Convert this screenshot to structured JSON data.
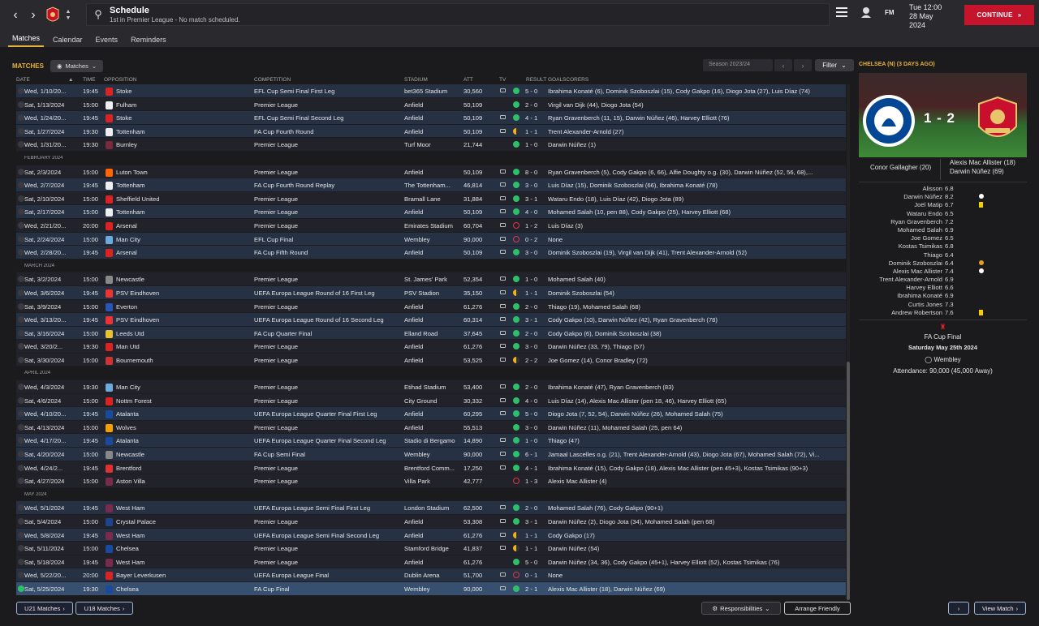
{
  "header": {
    "title": "Schedule",
    "subtitle": "1st in Premier League - No match scheduled.",
    "day_time": "Tue 12:00",
    "date_line1": "28 May",
    "date_line2": "2024",
    "fm": "FM",
    "continue_label": "CONTINUE"
  },
  "tabs": [
    "Matches",
    "Calendar",
    "Events",
    "Reminders"
  ],
  "toolbar": {
    "section_label": "MATCHES",
    "view_dropdown": "Matches",
    "season": "Season 2023/24",
    "filter": "Filter"
  },
  "columns": {
    "date": "DATE",
    "time": "TIME",
    "opposition": "OPPOSITION",
    "competition": "COMPETITION",
    "stadium": "STADIUM",
    "att": "ATT",
    "tv": "TV",
    "result": "RESULT",
    "goalscorers": "GOALSCORERS"
  },
  "colors": {
    "accent": "#e8b23a",
    "continue": "#c5142c",
    "win": "#2fbf6a",
    "loss": "#e0364c",
    "draw": "#f0b020",
    "row_home": "#263244",
    "row_alt": "#22222a",
    "row_selected": "#37506f"
  },
  "rows": [
    {
      "date": "Wed, 1/10/20...",
      "time": "19:45",
      "opp": "Stoke",
      "comp": "EFL Cup Semi Final First Leg",
      "stadium": "bet365 Stadium",
      "att": "30,560",
      "tv": true,
      "res": "w",
      "score": "5 - 0",
      "scorers": "Ibrahima Konaté (6), Dominik Szoboszlai (15), Cody Gakpo (16), Diogo Jota (27), Luis Díaz (74)",
      "crest": "#d22",
      "cls": "odd"
    },
    {
      "date": "Sat, 1/13/2024",
      "time": "15:00",
      "opp": "Fulham",
      "comp": "Premier League",
      "stadium": "Anfield",
      "att": "50,109",
      "tv": false,
      "res": "w",
      "score": "2 - 0",
      "scorers": "Virgil van Dijk (44), Diogo Jota (54)",
      "crest": "#eee",
      "cls": "even"
    },
    {
      "date": "Wed, 1/24/20...",
      "time": "19:45",
      "opp": "Stoke",
      "comp": "EFL Cup Semi Final Second Leg",
      "stadium": "Anfield",
      "att": "50,109",
      "tv": true,
      "res": "w",
      "score": "4 - 1",
      "scorers": "Ryan Gravenberch (11, 15), Darwin Núñez (46), Harvey Elliott (76)",
      "crest": "#d22",
      "cls": "odd"
    },
    {
      "date": "Sat, 1/27/2024",
      "time": "19:30",
      "opp": "Tottenham",
      "comp": "FA Cup Fourth Round",
      "stadium": "Anfield",
      "att": "50,109",
      "tv": true,
      "res": "d",
      "score": "1 - 1",
      "scorers": "Trent Alexander-Arnold (27)",
      "crest": "#eee",
      "cls": "odd"
    },
    {
      "date": "Wed, 1/31/20...",
      "time": "19:30",
      "opp": "Burnley",
      "comp": "Premier League",
      "stadium": "Turf Moor",
      "att": "21,744",
      "tv": false,
      "res": "w",
      "score": "1 - 0",
      "scorers": "Darwin Núñez (1)",
      "crest": "#7a2a3a",
      "cls": "even"
    },
    {
      "sep": "FEBRUARY 2024"
    },
    {
      "date": "Sat, 2/3/2024",
      "time": "15:00",
      "opp": "Luton Town",
      "comp": "Premier League",
      "stadium": "Anfield",
      "att": "50,109",
      "tv": true,
      "res": "w",
      "score": "8 - 0",
      "scorers": "Ryan Gravenberch (5), Cody Gakpo (6, 66), Alfie Doughty o.g. (30), Darwin Núñez (52, 56, 68),...",
      "crest": "#f60",
      "cls": "even"
    },
    {
      "date": "Wed, 2/7/2024",
      "time": "19:45",
      "opp": "Tottenham",
      "comp": "FA Cup Fourth Round Replay",
      "stadium": "The Tottenham...",
      "att": "46,814",
      "tv": true,
      "res": "w",
      "score": "3 - 0",
      "scorers": "Luis Díaz (15), Dominik Szoboszlai (66), Ibrahima Konaté (78)",
      "crest": "#eee",
      "cls": "odd"
    },
    {
      "date": "Sat, 2/10/2024",
      "time": "15:00",
      "opp": "Sheffield United",
      "comp": "Premier League",
      "stadium": "Bramall Lane",
      "att": "31,884",
      "tv": true,
      "res": "w",
      "score": "3 - 1",
      "scorers": "Wataru Endo (18), Luis Díaz (42), Diogo Jota (89)",
      "crest": "#d22",
      "cls": "even"
    },
    {
      "date": "Sat, 2/17/2024",
      "time": "15:00",
      "opp": "Tottenham",
      "comp": "Premier League",
      "stadium": "Anfield",
      "att": "50,109",
      "tv": true,
      "res": "w",
      "score": "4 - 0",
      "scorers": "Mohamed Salah (10, pen 88), Cody Gakpo (25), Harvey Elliott (68)",
      "crest": "#eee",
      "cls": "odd"
    },
    {
      "date": "Wed, 2/21/20...",
      "time": "20:00",
      "opp": "Arsenal",
      "comp": "Premier League",
      "stadium": "Emirates Stadium",
      "att": "60,704",
      "tv": true,
      "res": "l",
      "score": "1 - 2",
      "scorers": "Luis Díaz (3)",
      "crest": "#d22",
      "cls": "even"
    },
    {
      "date": "Sat, 2/24/2024",
      "time": "15:00",
      "opp": "Man City",
      "comp": "EFL Cup Final",
      "stadium": "Wembley",
      "att": "90,000",
      "tv": true,
      "res": "l",
      "score": "0 - 2",
      "scorers": "None",
      "crest": "#6cabdd",
      "cls": "odd"
    },
    {
      "date": "Wed, 2/28/20...",
      "time": "19:45",
      "opp": "Arsenal",
      "comp": "FA Cup Fifth Round",
      "stadium": "Anfield",
      "att": "50,109",
      "tv": true,
      "res": "w",
      "score": "3 - 0",
      "scorers": "Dominik Szoboszlai (19), Virgil van Dijk (41), Trent Alexander-Arnold (52)",
      "crest": "#d22",
      "cls": "odd"
    },
    {
      "sep": "MARCH 2024"
    },
    {
      "date": "Sat, 3/2/2024",
      "time": "15:00",
      "opp": "Newcastle",
      "comp": "Premier League",
      "stadium": "St. James' Park",
      "att": "52,354",
      "tv": true,
      "res": "w",
      "score": "1 - 0",
      "scorers": "Mohamed Salah (40)",
      "crest": "#888",
      "cls": "even"
    },
    {
      "date": "Wed, 3/6/2024",
      "time": "19:45",
      "opp": "PSV Eindhoven",
      "comp": "UEFA Europa League Round of 16 First Leg",
      "stadium": "PSV Stadion",
      "att": "35,150",
      "tv": true,
      "res": "d",
      "score": "1 - 1",
      "scorers": "Dominik Szoboszlai (54)",
      "crest": "#e33",
      "cls": "odd"
    },
    {
      "date": "Sat, 3/9/2024",
      "time": "15:00",
      "opp": "Everton",
      "comp": "Premier League",
      "stadium": "Anfield",
      "att": "61,276",
      "tv": true,
      "res": "w",
      "score": "2 - 0",
      "scorers": "Thiago (19), Mohamed Salah (68)",
      "crest": "#2a55b8",
      "cls": "even"
    },
    {
      "date": "Wed, 3/13/20...",
      "time": "19:45",
      "opp": "PSV Eindhoven",
      "comp": "UEFA Europa League Round of 16 Second Leg",
      "stadium": "Anfield",
      "att": "60,314",
      "tv": true,
      "res": "w",
      "score": "3 - 1",
      "scorers": "Cody Gakpo (10), Darwin Núñez (42), Ryan Gravenberch (78)",
      "crest": "#e33",
      "cls": "odd"
    },
    {
      "date": "Sat, 3/16/2024",
      "time": "15:00",
      "opp": "Leeds Utd",
      "comp": "FA Cup Quarter Final",
      "stadium": "Elland Road",
      "att": "37,645",
      "tv": true,
      "res": "w",
      "score": "2 - 0",
      "scorers": "Cody Gakpo (6), Dominik Szoboszlai (38)",
      "crest": "#e8c030",
      "cls": "odd"
    },
    {
      "date": "Wed, 3/20/2...",
      "time": "19:30",
      "opp": "Man Utd",
      "comp": "Premier League",
      "stadium": "Anfield",
      "att": "61,276",
      "tv": true,
      "res": "w",
      "score": "3 - 0",
      "scorers": "Darwin Núñez (33, 79), Thiago (57)",
      "crest": "#d22",
      "cls": "even"
    },
    {
      "date": "Sat, 3/30/2024",
      "time": "15:00",
      "opp": "Bournemouth",
      "comp": "Premier League",
      "stadium": "Anfield",
      "att": "53,525",
      "tv": true,
      "res": "d",
      "score": "2 - 2",
      "scorers": "Joe Gomez (14), Conor Bradley (72)",
      "crest": "#c33",
      "cls": "even"
    },
    {
      "sep": "APRIL 2024"
    },
    {
      "date": "Wed, 4/3/2024",
      "time": "19:30",
      "opp": "Man City",
      "comp": "Premier League",
      "stadium": "Etihad Stadium",
      "att": "53,400",
      "tv": true,
      "res": "w",
      "score": "2 - 0",
      "scorers": "Ibrahima Konaté (47), Ryan Gravenberch (83)",
      "crest": "#6cabdd",
      "cls": "even"
    },
    {
      "date": "Sat, 4/6/2024",
      "time": "15:00",
      "opp": "Nottm Forest",
      "comp": "Premier League",
      "stadium": "City Ground",
      "att": "30,332",
      "tv": true,
      "res": "w",
      "score": "4 - 0",
      "scorers": "Luis Díaz (14), Alexis Mac Allister (pen 18, 46), Harvey Elliott (65)",
      "crest": "#d22",
      "cls": "even"
    },
    {
      "date": "Wed, 4/10/20...",
      "time": "19:45",
      "opp": "Atalanta",
      "comp": "UEFA Europa League Quarter Final First Leg",
      "stadium": "Anfield",
      "att": "60,295",
      "tv": true,
      "res": "w",
      "score": "5 - 0",
      "scorers": "Diogo Jota (7, 52, 54), Darwin Núñez (26), Mohamed Salah (75)",
      "crest": "#1a4aa0",
      "cls": "odd"
    },
    {
      "date": "Sat, 4/13/2024",
      "time": "15:00",
      "opp": "Wolves",
      "comp": "Premier League",
      "stadium": "Anfield",
      "att": "55,513",
      "tv": false,
      "res": "w",
      "score": "3 - 0",
      "scorers": "Darwin Núñez (11), Mohamed Salah (25, pen 64)",
      "crest": "#f5a000",
      "cls": "even"
    },
    {
      "date": "Wed, 4/17/20...",
      "time": "19:45",
      "opp": "Atalanta",
      "comp": "UEFA Europa League Quarter Final Second Leg",
      "stadium": "Stadio di Bergamo",
      "att": "14,890",
      "tv": true,
      "res": "w",
      "score": "1 - 0",
      "scorers": "Thiago (47)",
      "crest": "#1a4aa0",
      "cls": "odd"
    },
    {
      "date": "Sat, 4/20/2024",
      "time": "15:00",
      "opp": "Newcastle",
      "comp": "FA Cup Semi Final",
      "stadium": "Wembley",
      "att": "90,000",
      "tv": true,
      "res": "w",
      "score": "6 - 1",
      "scorers": "Jamaal Lascelles o.g. (21), Trent Alexander-Arnold (43), Diogo Jota (67), Mohamed Salah (72), Vi...",
      "crest": "#888",
      "cls": "odd"
    },
    {
      "date": "Wed, 4/24/2...",
      "time": "19:45",
      "opp": "Brentford",
      "comp": "Premier League",
      "stadium": "Brentford Comm...",
      "att": "17,250",
      "tv": true,
      "res": "w",
      "score": "4 - 1",
      "scorers": "Ibrahima Konaté (15), Cody Gakpo (18), Alexis Mac Allister (pen 45+3), Kostas Tsimikas (90+3)",
      "crest": "#e03030",
      "cls": "even"
    },
    {
      "date": "Sat, 4/27/2024",
      "time": "15:00",
      "opp": "Aston Villa",
      "comp": "Premier League",
      "stadium": "Villa Park",
      "att": "42,777",
      "tv": false,
      "res": "l",
      "score": "1 - 3",
      "scorers": "Alexis Mac Allister (4)",
      "crest": "#7a2a4a",
      "cls": "even"
    },
    {
      "sep": "MAY 2024"
    },
    {
      "date": "Wed, 5/1/2024",
      "time": "19:45",
      "opp": "West Ham",
      "comp": "UEFA Europa League Semi Final First Leg",
      "stadium": "London Stadium",
      "att": "62,500",
      "tv": true,
      "res": "w",
      "score": "2 - 0",
      "scorers": "Mohamed Salah (76), Cody Gakpo (90+1)",
      "crest": "#7a2a4a",
      "cls": "odd"
    },
    {
      "date": "Sat, 5/4/2024",
      "time": "15:00",
      "opp": "Crystal Palace",
      "comp": "Premier League",
      "stadium": "Anfield",
      "att": "53,308",
      "tv": true,
      "res": "w",
      "score": "3 - 1",
      "scorers": "Darwin Núñez (2), Diogo Jota (34), Mohamed Salah (pen 68)",
      "crest": "#1b458f",
      "cls": "even"
    },
    {
      "date": "Wed, 5/8/2024",
      "time": "19:45",
      "opp": "West Ham",
      "comp": "UEFA Europa League Semi Final Second Leg",
      "stadium": "Anfield",
      "att": "61,276",
      "tv": true,
      "res": "d",
      "score": "1 - 1",
      "scorers": "Cody Gakpo (17)",
      "crest": "#7a2a4a",
      "cls": "odd"
    },
    {
      "date": "Sat, 5/11/2024",
      "time": "15:00",
      "opp": "Chelsea",
      "comp": "Premier League",
      "stadium": "Stamford Bridge",
      "att": "41,837",
      "tv": true,
      "res": "d",
      "score": "1 - 1",
      "scorers": "Darwin Núñez (54)",
      "crest": "#1a4aa0",
      "cls": "even"
    },
    {
      "date": "Sat, 5/18/2024",
      "time": "19:45",
      "opp": "West Ham",
      "comp": "Premier League",
      "stadium": "Anfield",
      "att": "61,276",
      "tv": false,
      "res": "w",
      "score": "5 - 0",
      "scorers": "Darwin Núñez (34, 36), Cody Gakpo (45+1), Harvey Elliott (52), Kostas Tsimikas (76)",
      "crest": "#7a2a4a",
      "cls": "even"
    },
    {
      "date": "Wed, 5/22/20...",
      "time": "20:00",
      "opp": "Bayer Leverkusen",
      "comp": "UEFA Europa League Final",
      "stadium": "Dublin Arena",
      "att": "51,700",
      "tv": true,
      "res": "l",
      "score": "0 - 1",
      "scorers": "None",
      "crest": "#d22",
      "cls": "odd"
    },
    {
      "date": "Sat, 5/25/2024",
      "time": "19:30",
      "opp": "Chelsea",
      "comp": "FA Cup Final",
      "stadium": "Wembley",
      "att": "90,000",
      "tv": true,
      "res": "w",
      "score": "2 - 1",
      "scorers": "Alexis Mac Allister (18), Darwin Núñez (69)",
      "crest": "#1a4aa0",
      "cls": "sel"
    }
  ],
  "bottom": {
    "u21": "U21 Matches",
    "u18": "U18 Matches",
    "responsibilities": "Responsibilities",
    "arrange": "Arrange Friendly",
    "view_match": "View Match"
  },
  "side": {
    "title": "CHELSEA (N) (3 DAYS AGO)",
    "score": "1 - 2",
    "home_scorers": "Conor Gallagher (20)",
    "away_scorers": [
      "Alexis Mac Allister (18)",
      "Darwin Núñez (69)"
    ],
    "lineup": [
      {
        "name": "Alisson",
        "rating": "6.8",
        "event": ""
      },
      {
        "name": "Darwin Núñez",
        "rating": "8.2",
        "event": "goal"
      },
      {
        "name": "Joël Matip",
        "rating": "6.7",
        "event": "yellow"
      },
      {
        "name": "Wataru Endo",
        "rating": "6.5",
        "event": ""
      },
      {
        "name": "Ryan Gravenberch",
        "rating": "7.2",
        "event": ""
      },
      {
        "name": "Mohamed Salah",
        "rating": "6.9",
        "event": ""
      },
      {
        "name": "Joe Gomez",
        "rating": "6.5",
        "event": ""
      },
      {
        "name": "Kostas Tsimikas",
        "rating": "6.8",
        "event": ""
      },
      {
        "name": "Thiago",
        "rating": "6.4",
        "event": ""
      },
      {
        "name": "Dominik Szoboszlai",
        "rating": "6.4",
        "event": "sub"
      },
      {
        "name": "Alexis Mac Allister",
        "rating": "7.4",
        "event": "goal"
      },
      {
        "name": "Trent Alexander-Arnold",
        "rating": "6.9",
        "event": ""
      },
      {
        "name": "Harvey Elliott",
        "rating": "6.6",
        "event": ""
      },
      {
        "name": "Ibrahima Konaté",
        "rating": "6.9",
        "event": ""
      },
      {
        "name": "Curtis Jones",
        "rating": "7.3",
        "event": ""
      },
      {
        "name": "Andrew Robertson",
        "rating": "7.6",
        "event": "yellow"
      }
    ],
    "competition": "FA Cup Final",
    "match_date": "Saturday May 25th 2024",
    "stadium": "Wembley",
    "attendance": "Attendance: 90,000 (45,000 Away)"
  }
}
